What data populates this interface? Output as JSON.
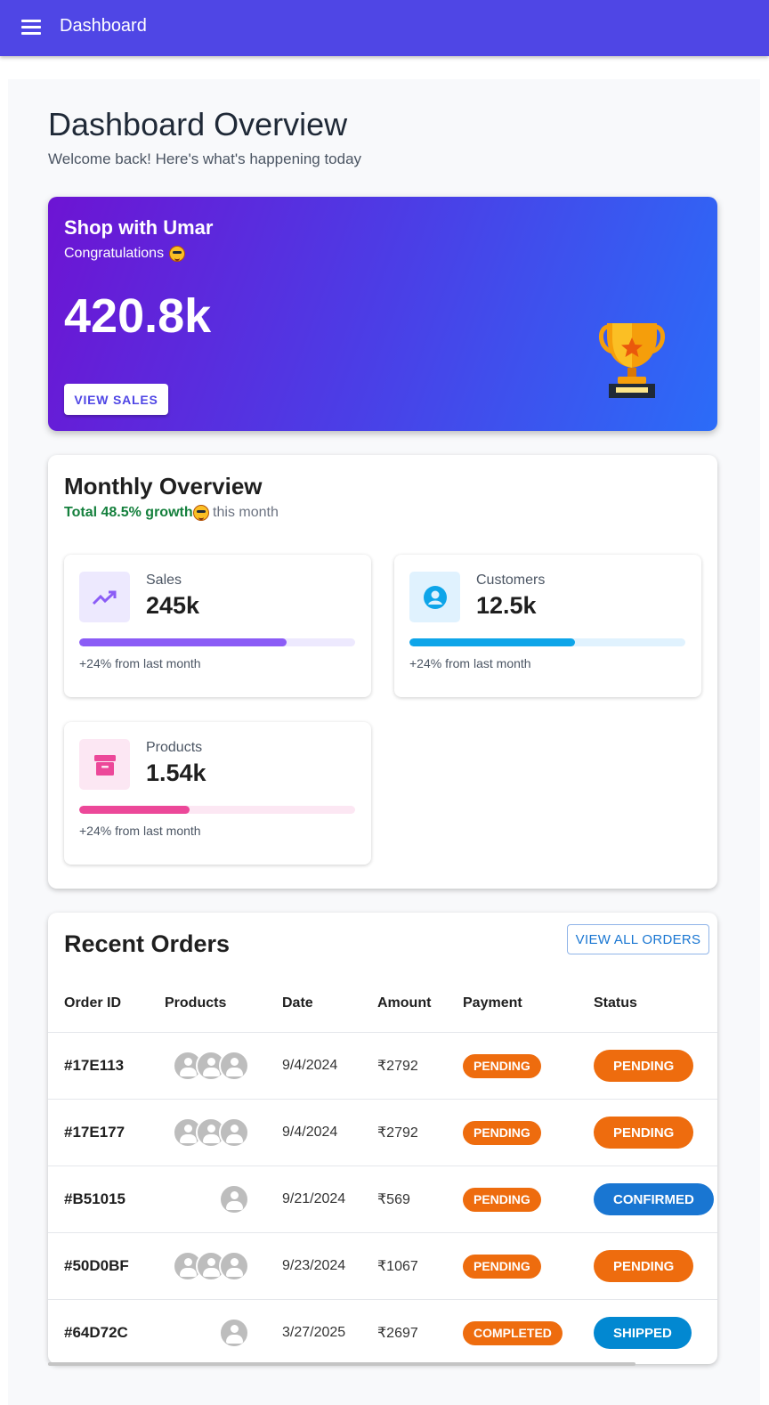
{
  "appbar": {
    "title": "Dashboard"
  },
  "header": {
    "title": "Dashboard Overview",
    "subtitle": "Welcome back! Here's what's happening today"
  },
  "hero": {
    "shop": "Shop with Umar",
    "congrats": "Congratulations",
    "value": "420.8k",
    "button": "VIEW SALES",
    "trophy_icon": "trophy-icon"
  },
  "overview": {
    "title": "Monthly Overview",
    "growth": "Total 48.5% growth",
    "growth_suffix": " this month",
    "stats": [
      {
        "label": "Sales",
        "value": "245k",
        "note": "+24% from last month",
        "progress": 0.75,
        "color": "#8b5cf6",
        "track": "#ede9fe",
        "icon_bg": "#ede9fe",
        "icon": "trending-up-icon"
      },
      {
        "label": "Customers",
        "value": "12.5k",
        "note": "+24% from last month",
        "progress": 0.6,
        "color": "#0ea5e9",
        "track": "#e0f2fe",
        "icon_bg": "#e0f2fe",
        "icon": "account-icon"
      },
      {
        "label": "Products",
        "value": "1.54k",
        "note": "+24% from last month",
        "progress": 0.4,
        "color": "#ec4899",
        "track": "#fce7f3",
        "icon_bg": "#fce7f3",
        "icon": "archive-icon"
      }
    ]
  },
  "orders": {
    "title": "Recent Orders",
    "view_all": "VIEW ALL ORDERS",
    "columns": [
      "Order ID",
      "Products",
      "Date",
      "Amount",
      "Payment",
      "Status"
    ],
    "rows": [
      {
        "id": "#17E113",
        "products": 3,
        "date": "9/4/2024",
        "amount": "₹2792",
        "payment": "PENDING",
        "status": "PENDING",
        "status_color": "#ee6c0e"
      },
      {
        "id": "#17E177",
        "products": 3,
        "date": "9/4/2024",
        "amount": "₹2792",
        "payment": "PENDING",
        "status": "PENDING",
        "status_color": "#ee6c0e"
      },
      {
        "id": "#B51015",
        "products": 1,
        "date": "9/21/2024",
        "amount": "₹569",
        "payment": "PENDING",
        "status": "CONFIRMED",
        "status_color": "#1976d2"
      },
      {
        "id": "#50D0BF",
        "products": 3,
        "date": "9/23/2024",
        "amount": "₹1067",
        "payment": "PENDING",
        "status": "PENDING",
        "status_color": "#ee6c0e"
      },
      {
        "id": "#64D72C",
        "products": 1,
        "date": "3/27/2025",
        "amount": "₹2697",
        "payment": "COMPLETED",
        "status": "SHIPPED",
        "status_color": "#0288d1"
      }
    ]
  }
}
